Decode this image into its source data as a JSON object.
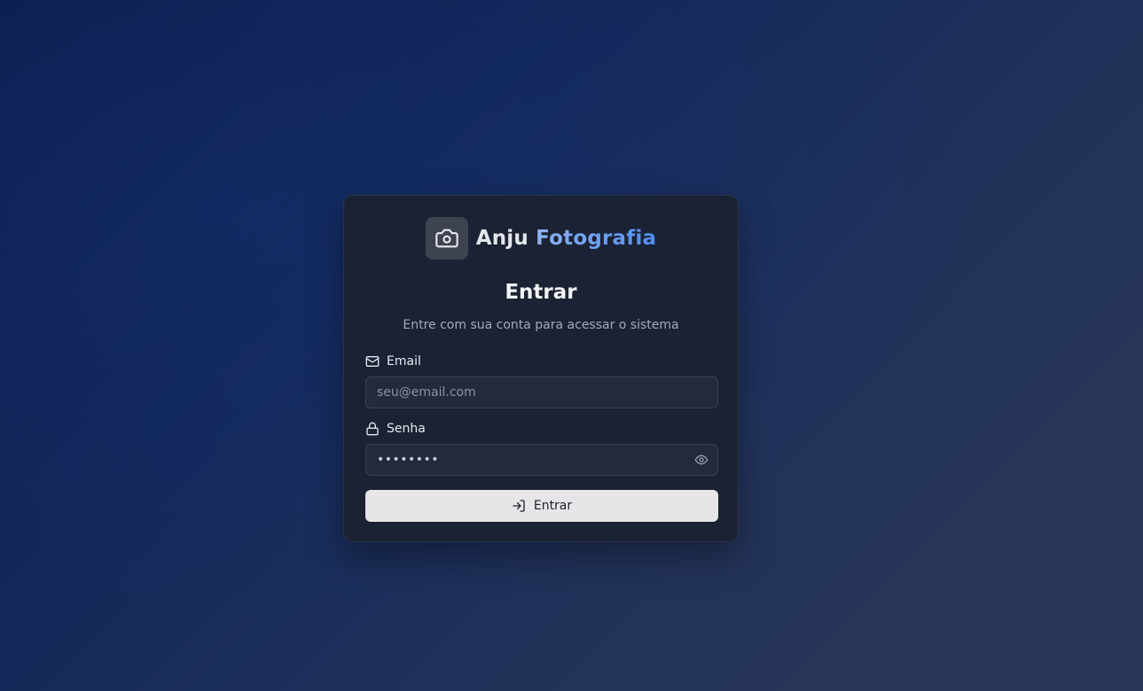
{
  "brand": {
    "name_part1": "Anju",
    "name_part2": "Fotografia",
    "logo_icon": "camera-icon"
  },
  "login": {
    "title": "Entrar",
    "subtitle": "Entre com sua conta para acessar o sistema",
    "email": {
      "label": "Email",
      "icon": "mail-icon",
      "placeholder": "seu@email.com",
      "value": ""
    },
    "password": {
      "label": "Senha",
      "icon": "lock-icon",
      "masked_value": "••••••••",
      "toggle_icon": "eye-icon"
    },
    "submit": {
      "label": "Entrar",
      "icon": "log-in-icon"
    }
  },
  "colors": {
    "card_background": "#1b2233",
    "accent_gradient_start": "#8fb3f2",
    "accent_gradient_end": "#4f8ef2",
    "button_background": "#e6e6e8"
  }
}
